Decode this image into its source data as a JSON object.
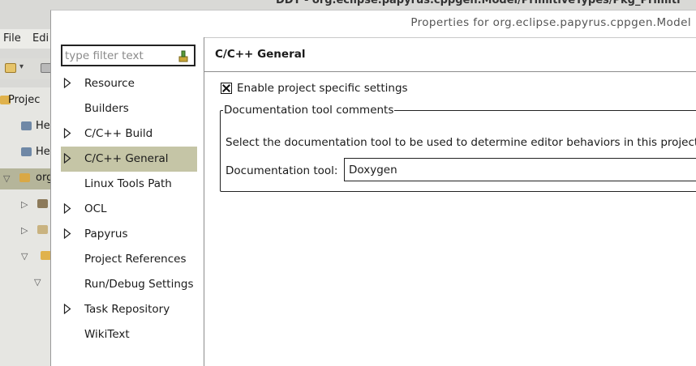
{
  "background_window": {
    "title": "DDT - org.eclipse.papyrus.cppgen.Model/PrimitiveTypes/Pkg_Primiti",
    "menu": [
      "File",
      "Edi"
    ],
    "explorer_items": [
      {
        "label": "Projec",
        "icon": "folder-icon",
        "selected": false
      },
      {
        "label": "He",
        "icon": "library-icon",
        "selected": false
      },
      {
        "label": "He",
        "icon": "library-icon",
        "selected": false
      },
      {
        "label": "org",
        "icon": "project-icon",
        "selected": true
      },
      {
        "label": "",
        "icon": "package-icon",
        "selected": false
      },
      {
        "label": "",
        "icon": "file-icon",
        "selected": false
      },
      {
        "label": "",
        "icon": "folder-icon",
        "selected": false
      },
      {
        "label": "",
        "icon": "chevron-down-icon",
        "selected": false
      }
    ]
  },
  "dialog": {
    "title": "Properties for org.eclipse.papyrus.cppgen.Model",
    "filter": {
      "placeholder": "type filter text",
      "value": ""
    },
    "tree": [
      {
        "label": "Resource",
        "expandable": true,
        "selected": false
      },
      {
        "label": "Builders",
        "expandable": false,
        "selected": false
      },
      {
        "label": "C/C++ Build",
        "expandable": true,
        "selected": false
      },
      {
        "label": "C/C++ General",
        "expandable": true,
        "selected": true
      },
      {
        "label": "Linux Tools Path",
        "expandable": false,
        "selected": false
      },
      {
        "label": "OCL",
        "expandable": true,
        "selected": false
      },
      {
        "label": "Papyrus",
        "expandable": true,
        "selected": false
      },
      {
        "label": "Project References",
        "expandable": false,
        "selected": false
      },
      {
        "label": "Run/Debug Settings",
        "expandable": false,
        "selected": false
      },
      {
        "label": "Task Repository",
        "expandable": true,
        "selected": false
      },
      {
        "label": "WikiText",
        "expandable": false,
        "selected": false
      }
    ],
    "page": {
      "title": "C/C++ General",
      "enable_label": "Enable project specific settings",
      "enable_checked": true,
      "group_title": "Documentation tool comments",
      "group_description": "Select the documentation tool to be used to determine editor behaviors in this project",
      "doc_tool_label": "Documentation tool:",
      "doc_tool_value": "Doxygen"
    }
  },
  "colors": {
    "selection": "#c5c5a6",
    "background": "#d9d9d6"
  }
}
